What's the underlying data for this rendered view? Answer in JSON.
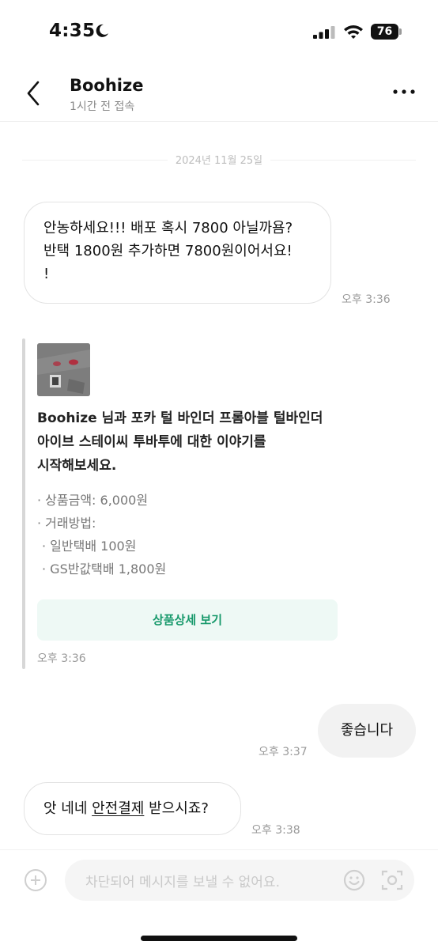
{
  "status_bar": {
    "time": "4:35",
    "battery": "76"
  },
  "header": {
    "name": "Boohize",
    "status": "1시간 전 접속"
  },
  "date_divider": "2024년 11월 25일",
  "messages": [
    {
      "lines": [
        "안농하세요!!! 배포 혹시 7800 아닐까욤?",
        "반택 1800원 추가하면 7800원이어서요!",
        "!"
      ],
      "time": "오후 3:36"
    }
  ],
  "product_card": {
    "title_lines": [
      "Boohize 님과 포카 털 바인더 프롬아블 털바인더",
      "아이브 스테이씨 투바투에 대한 이야기를",
      "시작해보세요."
    ],
    "details": [
      "· 상품금액: 6,000원",
      "· 거래방법:",
      "· 일반택배 100원",
      "· GS반값택배 1,800원"
    ],
    "button_label": "상품상세 보기",
    "time": "오후 3:36"
  },
  "reply": {
    "text": "좋습니다",
    "time": "오후 3:37"
  },
  "last_message": {
    "prefix": "앗 네네 ",
    "link": "안전결제",
    "suffix": " 받으시죠?",
    "time": "오후 3:38"
  },
  "input": {
    "placeholder": "차단되어 메시지를 보낼 수 없어요."
  },
  "icons": {
    "back": "chevron-left-icon",
    "more": "more-horizontal-icon",
    "plus": "plus-circle-icon",
    "emoji": "smile-icon",
    "camera": "camera-icon"
  },
  "colors": {
    "accent": "#17996b",
    "button_bg": "#eef9f5"
  }
}
